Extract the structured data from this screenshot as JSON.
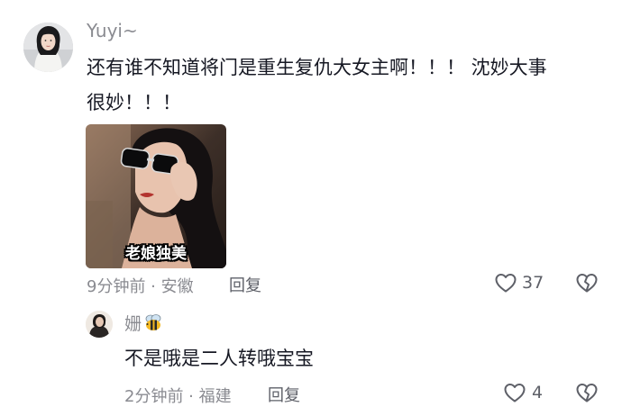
{
  "comment": {
    "username": "Yuyi~",
    "text_line1": "还有谁不知道将门是重生复仇大女主啊！！！ 沈妙大事",
    "text_line2": "很妙！！！",
    "sticker_caption": "老娘独美",
    "time": "9分钟前",
    "location": "安徽",
    "reply_label": "回复",
    "like_count": "37",
    "icons": {
      "like": "heart-outline-icon",
      "dislike": "broken-heart-icon"
    }
  },
  "reply": {
    "username": "姗",
    "username_badge": "bee-emoji",
    "text": "不是哦是二人转哦宝宝",
    "time": "2分钟前",
    "location": "福建",
    "reply_label": "回复",
    "like_count": "4",
    "icons": {
      "like": "heart-outline-icon",
      "dislike": "broken-heart-icon"
    }
  },
  "colors": {
    "primary_text": "#161823",
    "secondary_text": "#8a8b91",
    "action_text": "#5e6068"
  }
}
